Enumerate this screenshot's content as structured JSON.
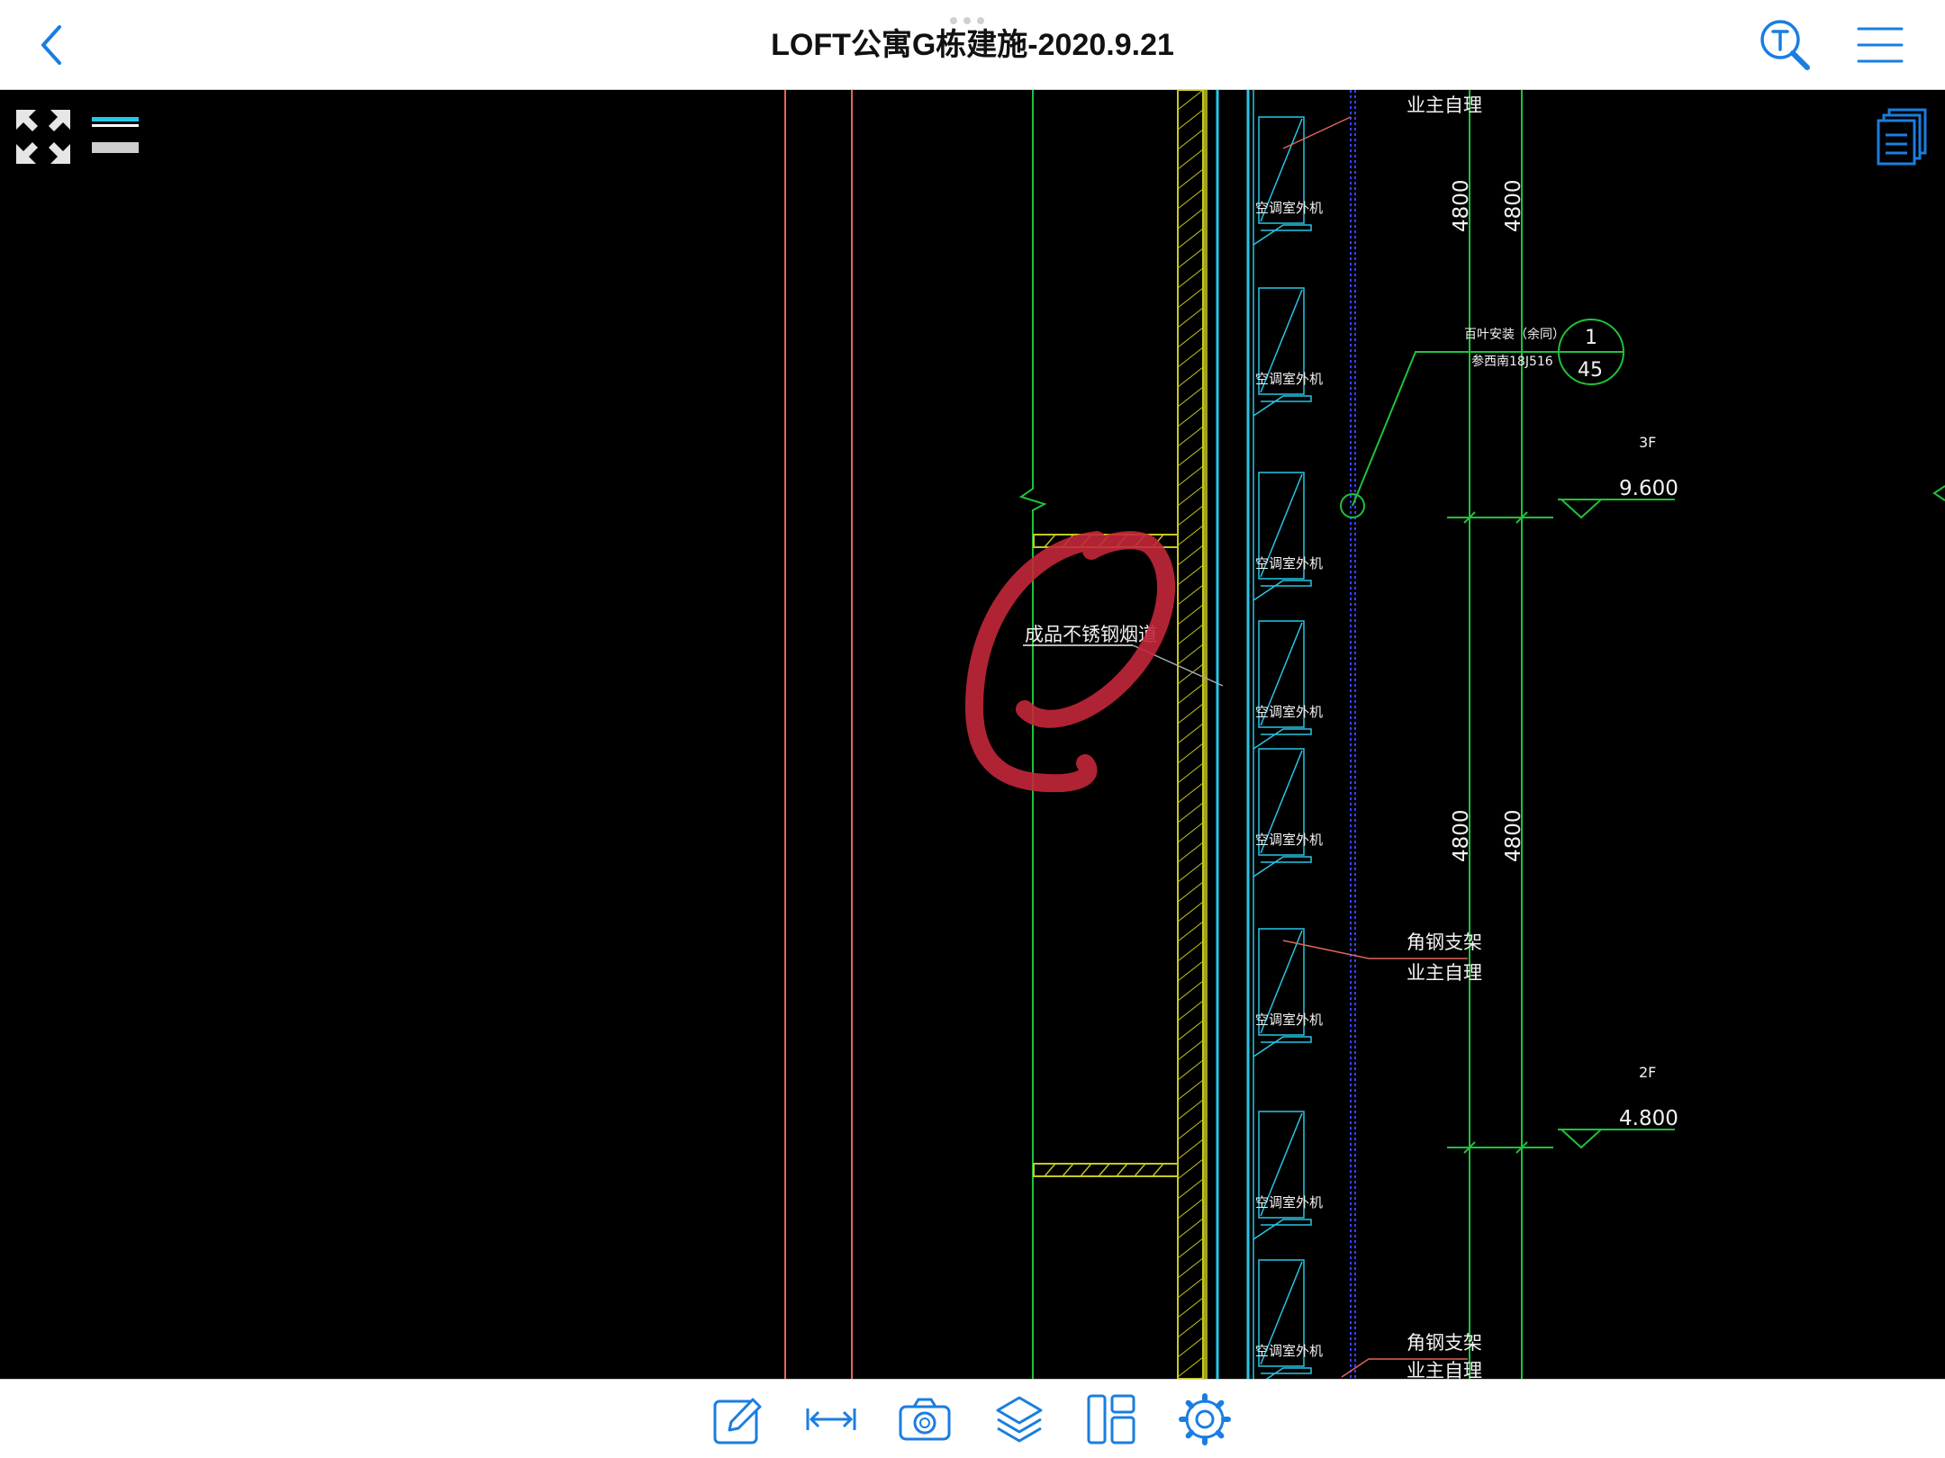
{
  "header": {
    "title": "LOFT公寓G栋建施-2020.9.21"
  },
  "drawing": {
    "callout_label": "成品不锈钢烟道",
    "unit_label": "空调室外机",
    "owner_label": "业主自理",
    "bracket_label": "角钢支架",
    "dimension_value": "4800",
    "louver_note_line1": "百叶安装（余同）",
    "louver_note_line2": "参西南18J516",
    "detail_number": "1",
    "detail_sheet": "45",
    "level_3f_name": "3F",
    "level_3f_value": "9.600",
    "level_2f_name": "2F",
    "level_2f_value": "4.800"
  },
  "toolbar": {
    "tools": [
      "annotate-tool",
      "measure-tool",
      "camera-tool",
      "layers-tool",
      "layout-tool",
      "settings-tool"
    ]
  },
  "colors": {
    "accent": "#1a7ee0",
    "markup_red": "#c3273a",
    "cad_green": "#1fc23a",
    "cad_cyan": "#27c6e6",
    "cad_yellow": "#c8c81e",
    "cad_red": "#e0665c"
  }
}
